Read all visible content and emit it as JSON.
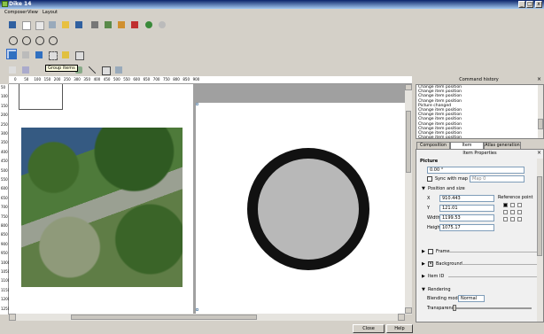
{
  "window": {
    "title": "Dike 14",
    "min": "_",
    "max": "□",
    "close": "x"
  },
  "menu": [
    "Composer",
    "View",
    "Layout"
  ],
  "tooltip": "Group items",
  "ruler": {
    "h": [
      "0",
      "50",
      "100",
      "150",
      "200",
      "250",
      "300",
      "350",
      "400",
      "450",
      "500",
      "550",
      "600",
      "650",
      "700",
      "750",
      "800",
      "850",
      "900"
    ],
    "v": [
      "50",
      "100",
      "150",
      "200",
      "250",
      "300",
      "350",
      "400",
      "450",
      "500",
      "550",
      "600",
      "650",
      "700",
      "750",
      "800",
      "850",
      "900",
      "950",
      "1000",
      "1050",
      "1100",
      "1150",
      "1200",
      "1250"
    ]
  },
  "history": {
    "title": "Command history",
    "items": [
      "Change item position",
      "Change item position",
      "Change item position",
      "Change item position",
      "Picture changed",
      "Change item position",
      "Change item position",
      "Change item position",
      "Change item position",
      "Change item position",
      "Change item position",
      "Change item position"
    ]
  },
  "tabs": [
    "Composition",
    "Item Properties",
    "Atlas generation"
  ],
  "props": {
    "title": "Item Properties",
    "picture_header": "Picture",
    "rotation": "0.00 °",
    "sync_with_map": "Sync with map",
    "map_select": "Map 0",
    "position_and_size": "Position and size",
    "x_label": "X",
    "x_value": "910.443",
    "y_label": "Y",
    "y_value": "121.01",
    "width_label": "Width",
    "width_value": "1199.53",
    "height_label": "Height",
    "height_value": "1075.17",
    "reference_point": "Reference point",
    "frame": "Frame",
    "background": "Background",
    "item_id": "Item ID",
    "rendering": "Rendering",
    "blending_mode_label": "Blending mode",
    "blending_mode_value": "Normal",
    "transparency_label": "Transparency"
  },
  "buttons": {
    "close": "Close",
    "help": "Help"
  },
  "colors": {
    "title_start": "#0b246a",
    "title_end": "#a6caf0",
    "canvas_bg": "#a0a0a0",
    "ring": "#111111",
    "circle_fill": "#b8b8b8"
  }
}
